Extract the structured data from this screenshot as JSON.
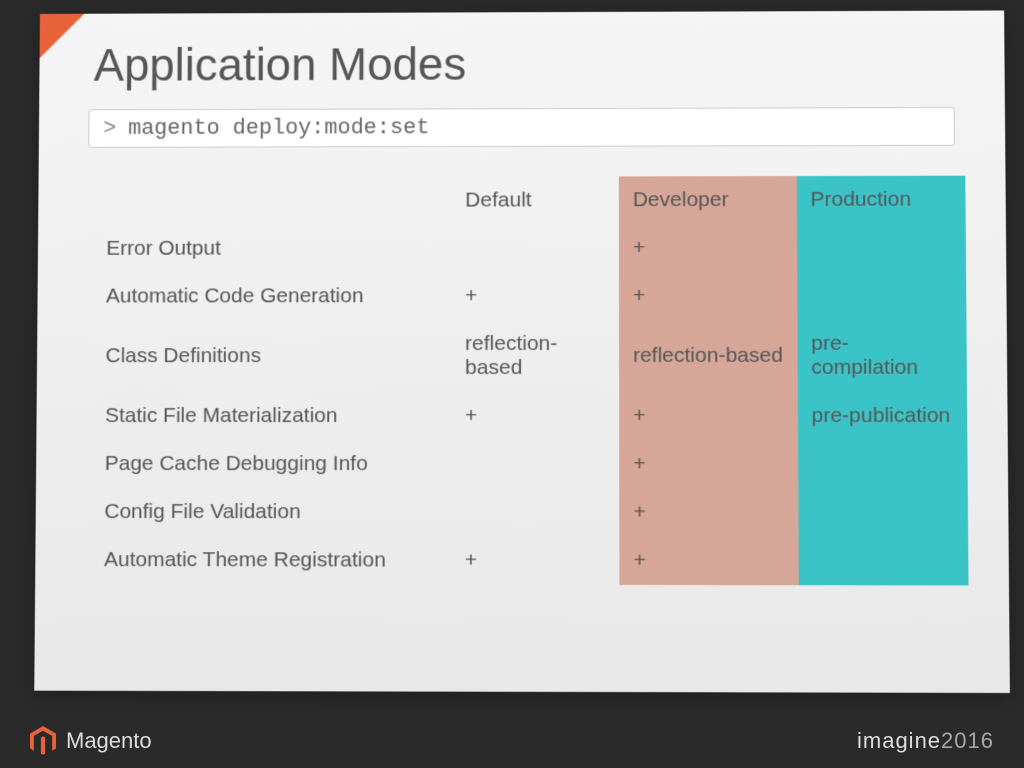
{
  "title": "Application Modes",
  "command": "magento deploy:mode:set",
  "columns": {
    "default": "Default",
    "developer": "Developer",
    "production": "Production"
  },
  "rows": [
    {
      "label": "Error Output",
      "default": "",
      "developer": "+",
      "production": ""
    },
    {
      "label": "Automatic Code Generation",
      "default": "+",
      "developer": "+",
      "production": ""
    },
    {
      "label": "Class Definitions",
      "default": "reflection-based",
      "developer": "reflection-based",
      "production": "pre-compilation"
    },
    {
      "label": "Static File Materialization",
      "default": "+",
      "developer": "+",
      "production": "pre-publication"
    },
    {
      "label": "Page Cache Debugging Info",
      "default": "",
      "developer": "+",
      "production": ""
    },
    {
      "label": "Config File Validation",
      "default": "",
      "developer": "+",
      "production": ""
    },
    {
      "label": "Automatic Theme Registration",
      "default": "+",
      "developer": "+",
      "production": ""
    }
  ],
  "footer": {
    "brand": "Magento",
    "event": "imagine",
    "year": "2016"
  }
}
